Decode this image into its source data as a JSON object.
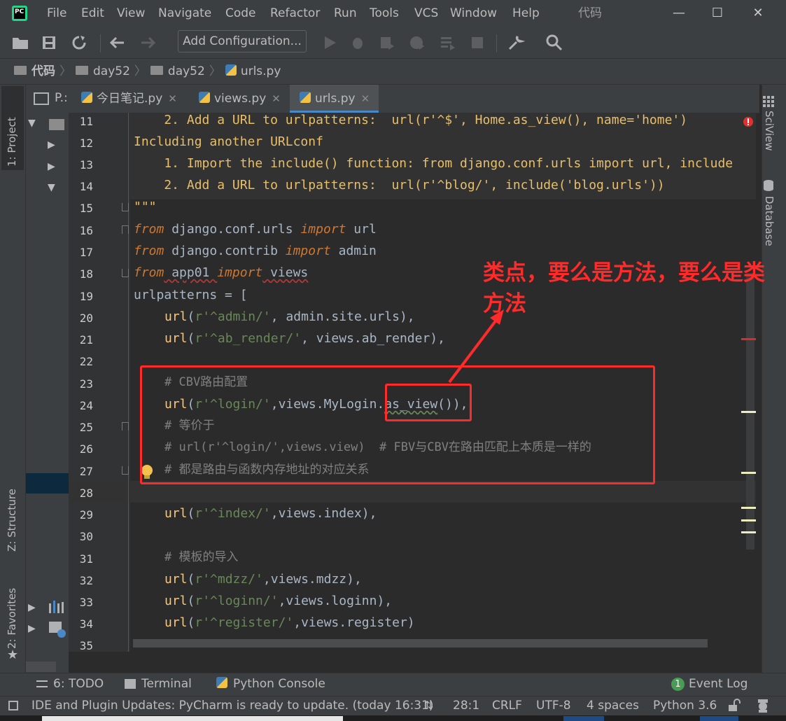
{
  "window": {
    "title": "代码"
  },
  "menu": [
    "File",
    "Edit",
    "View",
    "Navigate",
    "Code",
    "Refactor",
    "Run",
    "Tools",
    "VCS",
    "Window",
    "Help"
  ],
  "toolbar": {
    "add_configuration": "Add Configuration..."
  },
  "breadcrumb": [
    "代码",
    "day52",
    "day52",
    "urls.py"
  ],
  "left_strip": {
    "project": "1: Project",
    "structure": "Z: Structure",
    "favorites": "2: Favorites"
  },
  "right_strip": {
    "sciview": "SciView",
    "database": "Database"
  },
  "project_panel": {
    "label": "P.:"
  },
  "tabs": [
    {
      "label": "今日笔记.py",
      "active": false
    },
    {
      "label": "views.py",
      "active": false
    },
    {
      "label": "urls.py",
      "active": true
    }
  ],
  "editor": {
    "line_numbers": [
      "11",
      "12",
      "13",
      "14",
      "15",
      "16",
      "17",
      "18",
      "19",
      "20",
      "21",
      "22",
      "23",
      "24",
      "25",
      "26",
      "27",
      "28",
      "29",
      "30",
      "31",
      "32",
      "33",
      "34",
      "35"
    ],
    "lines": {
      "l11": "    2. Add a URL to urlpatterns:  url(r'^$', Home.as_view(), name='home')",
      "l12": "Including another URLconf",
      "l13": "    1. Import the include() function: from django.conf.urls import url, include",
      "l14": "    2. Add a URL to urlpatterns:  url(r'^blog/', include('blog.urls'))",
      "l15": "\"\"\"",
      "l16_kw1": "from",
      "l16_a": " django.conf.urls ",
      "l16_kw2": "import",
      "l16_b": " url",
      "l17_kw1": "from",
      "l17_a": " django.contrib ",
      "l17_kw2": "import",
      "l17_b": " admin",
      "l18_kw1": "from",
      "l18_a": " app01 ",
      "l18_kw2": "import",
      "l18_b": " views",
      "l19": "urlpatterns = [",
      "l20_fn": "url",
      "l20_a": "(",
      "l20_str": "r'^admin/'",
      "l20_b": ", admin.site.urls),",
      "l21_fn": "url",
      "l21_a": "(",
      "l21_str": "r'^ab_render/'",
      "l21_b": ", views.ab_render),",
      "l23": "# CBV路由配置",
      "l24_fn": "url",
      "l24_a": "(",
      "l24_str": "r'^login/'",
      "l24_b": ",views.MyLogin.",
      "l24_c": "as_view",
      "l24_d": "()),",
      "l25": "# 等价于",
      "l26": "# url(r'^login/',views.view)  # FBV与CBV在路由匹配上本质是一样的",
      "l27": "# 都是路由与函数内存地址的对应关系",
      "l29_fn": "url",
      "l29_a": "(",
      "l29_str": "r'^index/'",
      "l29_b": ",views.index),",
      "l31": "# 模板的导入",
      "l32_fn": "url",
      "l32_a": "(",
      "l32_str": "r'^mdzz/'",
      "l32_b": ",views.mdzz),",
      "l33_fn": "url",
      "l33_a": "(",
      "l33_str": "r'^loginn/'",
      "l33_b": ",views.loginn),",
      "l34_fn": "url",
      "l34_a": "(",
      "l34_str": "r'^register/'",
      "l34_b": ",views.register)"
    }
  },
  "annotation": {
    "text": "类点，要么是方法，要么是类方法"
  },
  "bottom_tools": {
    "todo": "6: TODO",
    "terminal": "Terminal",
    "python_console": "Python Console",
    "event_log": "Event Log",
    "event_count": "1"
  },
  "status": {
    "message": "IDE and Plugin Updates: PyCharm is ready to update. (today 16:31)",
    "position": "28:1",
    "line_sep": "CRLF",
    "encoding": "UTF-8",
    "indent": "4 spaces",
    "interpreter": "Python 3.6"
  },
  "colors": {
    "accent": "#4a88c7",
    "annotation_red": "#ff2b2b",
    "keyword": "#cc7832",
    "string": "#6a8759",
    "docstring": "#e8bf6a"
  }
}
